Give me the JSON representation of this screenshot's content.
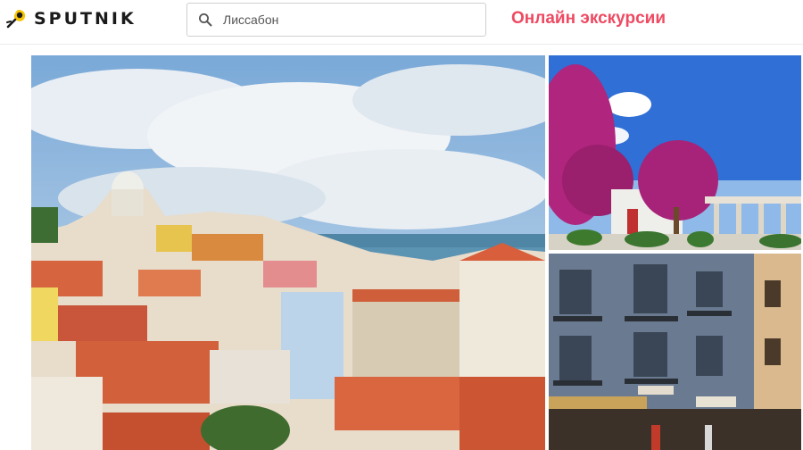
{
  "brand": {
    "name": "SPUTNIK",
    "accent": "#f6c400",
    "text_color": "#1a1a1a"
  },
  "search": {
    "placeholder": "Лиссабон",
    "value": "",
    "icon": "search-icon"
  },
  "nav": {
    "online_label": "Онлайн экскурсии",
    "color": "#ee4a62"
  },
  "gallery": {
    "photos": [
      {
        "name": "lisbon-panorama",
        "subject": "Lisbon rooftops and river view"
      },
      {
        "name": "bougainvillea-terrace",
        "subject": "Purple bougainvillea trees at a viewpoint"
      },
      {
        "name": "tiled-facade-street",
        "subject": "Blue azulejo tiled building facade"
      }
    ]
  }
}
